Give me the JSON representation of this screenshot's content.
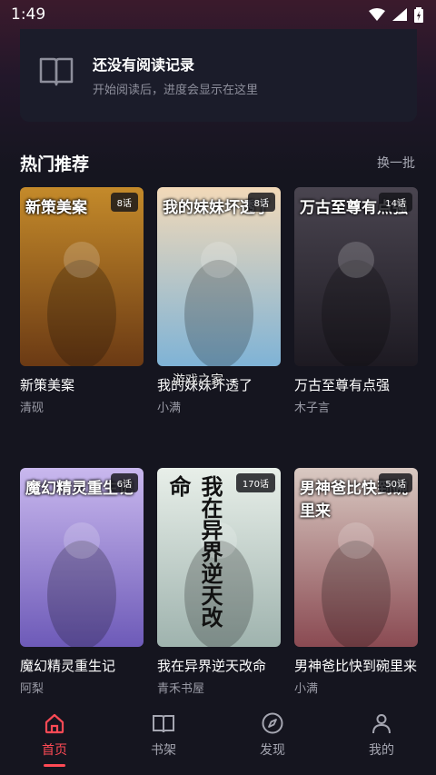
{
  "status": {
    "time": "1:49"
  },
  "history": {
    "title": "还没有阅读记录",
    "subtitle": "开始阅读后，进度会显示在这里"
  },
  "section": {
    "title": "热门推荐",
    "refresh": "换一批"
  },
  "books": [
    {
      "title": "新策美案",
      "author": "清砚",
      "badge": "8话",
      "cover_text": "新策美案",
      "color_a": "#c48a2a",
      "color_b": "#6b3a14"
    },
    {
      "title": "我的妹妹坏透了",
      "author": "小满",
      "badge": "8话",
      "cover_text": "我的妹妹坏透了",
      "color_a": "#f2d9b8",
      "color_b": "#7fb3d6"
    },
    {
      "title": "万古至尊有点强",
      "author": "木子言",
      "badge": "14话",
      "cover_text": "万古至尊有点强",
      "color_a": "#4a4550",
      "color_b": "#1d1a22"
    },
    {
      "title": "魔幻精灵重生记",
      "author": "阿梨",
      "badge": "6话",
      "cover_text": "魔幻精灵重生记",
      "color_a": "#c9b8ee",
      "color_b": "#6d5ab8"
    },
    {
      "title": "我在异界逆天改命",
      "author": "青禾书屋",
      "badge": "170话",
      "cover_text": "我在异界逆天改命",
      "color_a": "#e8efe9",
      "color_b": "#9fb3ae"
    },
    {
      "title": "男神爸比快到碗里来",
      "author": "小满",
      "badge": "50话",
      "cover_text": "男神爸比快到碗里来",
      "color_a": "#d9c9c2",
      "color_b": "#8a4a52"
    }
  ],
  "watermark": "游戏之家",
  "nav": [
    {
      "label": "首页",
      "icon": "home-icon"
    },
    {
      "label": "书架",
      "icon": "book-icon"
    },
    {
      "label": "发现",
      "icon": "compass-icon"
    },
    {
      "label": "我的",
      "icon": "user-icon"
    }
  ],
  "colors": {
    "accent": "#ff4a55",
    "background": "#15151f",
    "card": "#1b1c2a"
  }
}
